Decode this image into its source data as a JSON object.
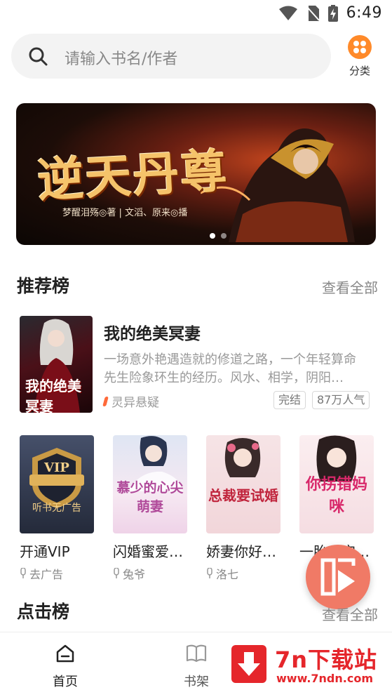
{
  "status_bar": {
    "time": "6:49"
  },
  "search": {
    "placeholder": "请输入书名/作者",
    "category_label": "分类"
  },
  "banner": {
    "title": "逆天丹尊",
    "subtitle": "梦醒泪殇◎著 | 文滔、原来◎播"
  },
  "recommend": {
    "title": "推荐榜",
    "more": "查看全部",
    "featured": {
      "title": "我的绝美冥妻",
      "cover_text": "我的绝美冥妻",
      "description": "一场意外艳遇造就的修道之路，一个年轻算命先生险象环生的经历。风水、相学，阴阳…",
      "genre": "灵异悬疑",
      "tags": [
        "完结",
        "87万人气"
      ]
    },
    "books": [
      {
        "title": "开通VIP",
        "author": "去广告",
        "cover_text": "VIP"
      },
      {
        "title": "闪婚蜜爱…",
        "author": "兔爷",
        "cover_text": "慕少的心尖萌妻"
      },
      {
        "title": "娇妻你好…",
        "author": "洛七",
        "cover_text": "总裁要试婚"
      },
      {
        "title": "一胎二宝…",
        "author": "",
        "cover_text": "你拐错妈咪"
      }
    ]
  },
  "hot": {
    "title": "点击榜",
    "more": "查看全部"
  },
  "bottom_nav": {
    "home": "首页",
    "shelf": "书架"
  },
  "watermark": {
    "name": "7n下载站",
    "url": "www.7ndn.com"
  },
  "colors": {
    "accent": "#ff8a2a",
    "fab": "#f07a66",
    "watermark": "#e5262b"
  }
}
